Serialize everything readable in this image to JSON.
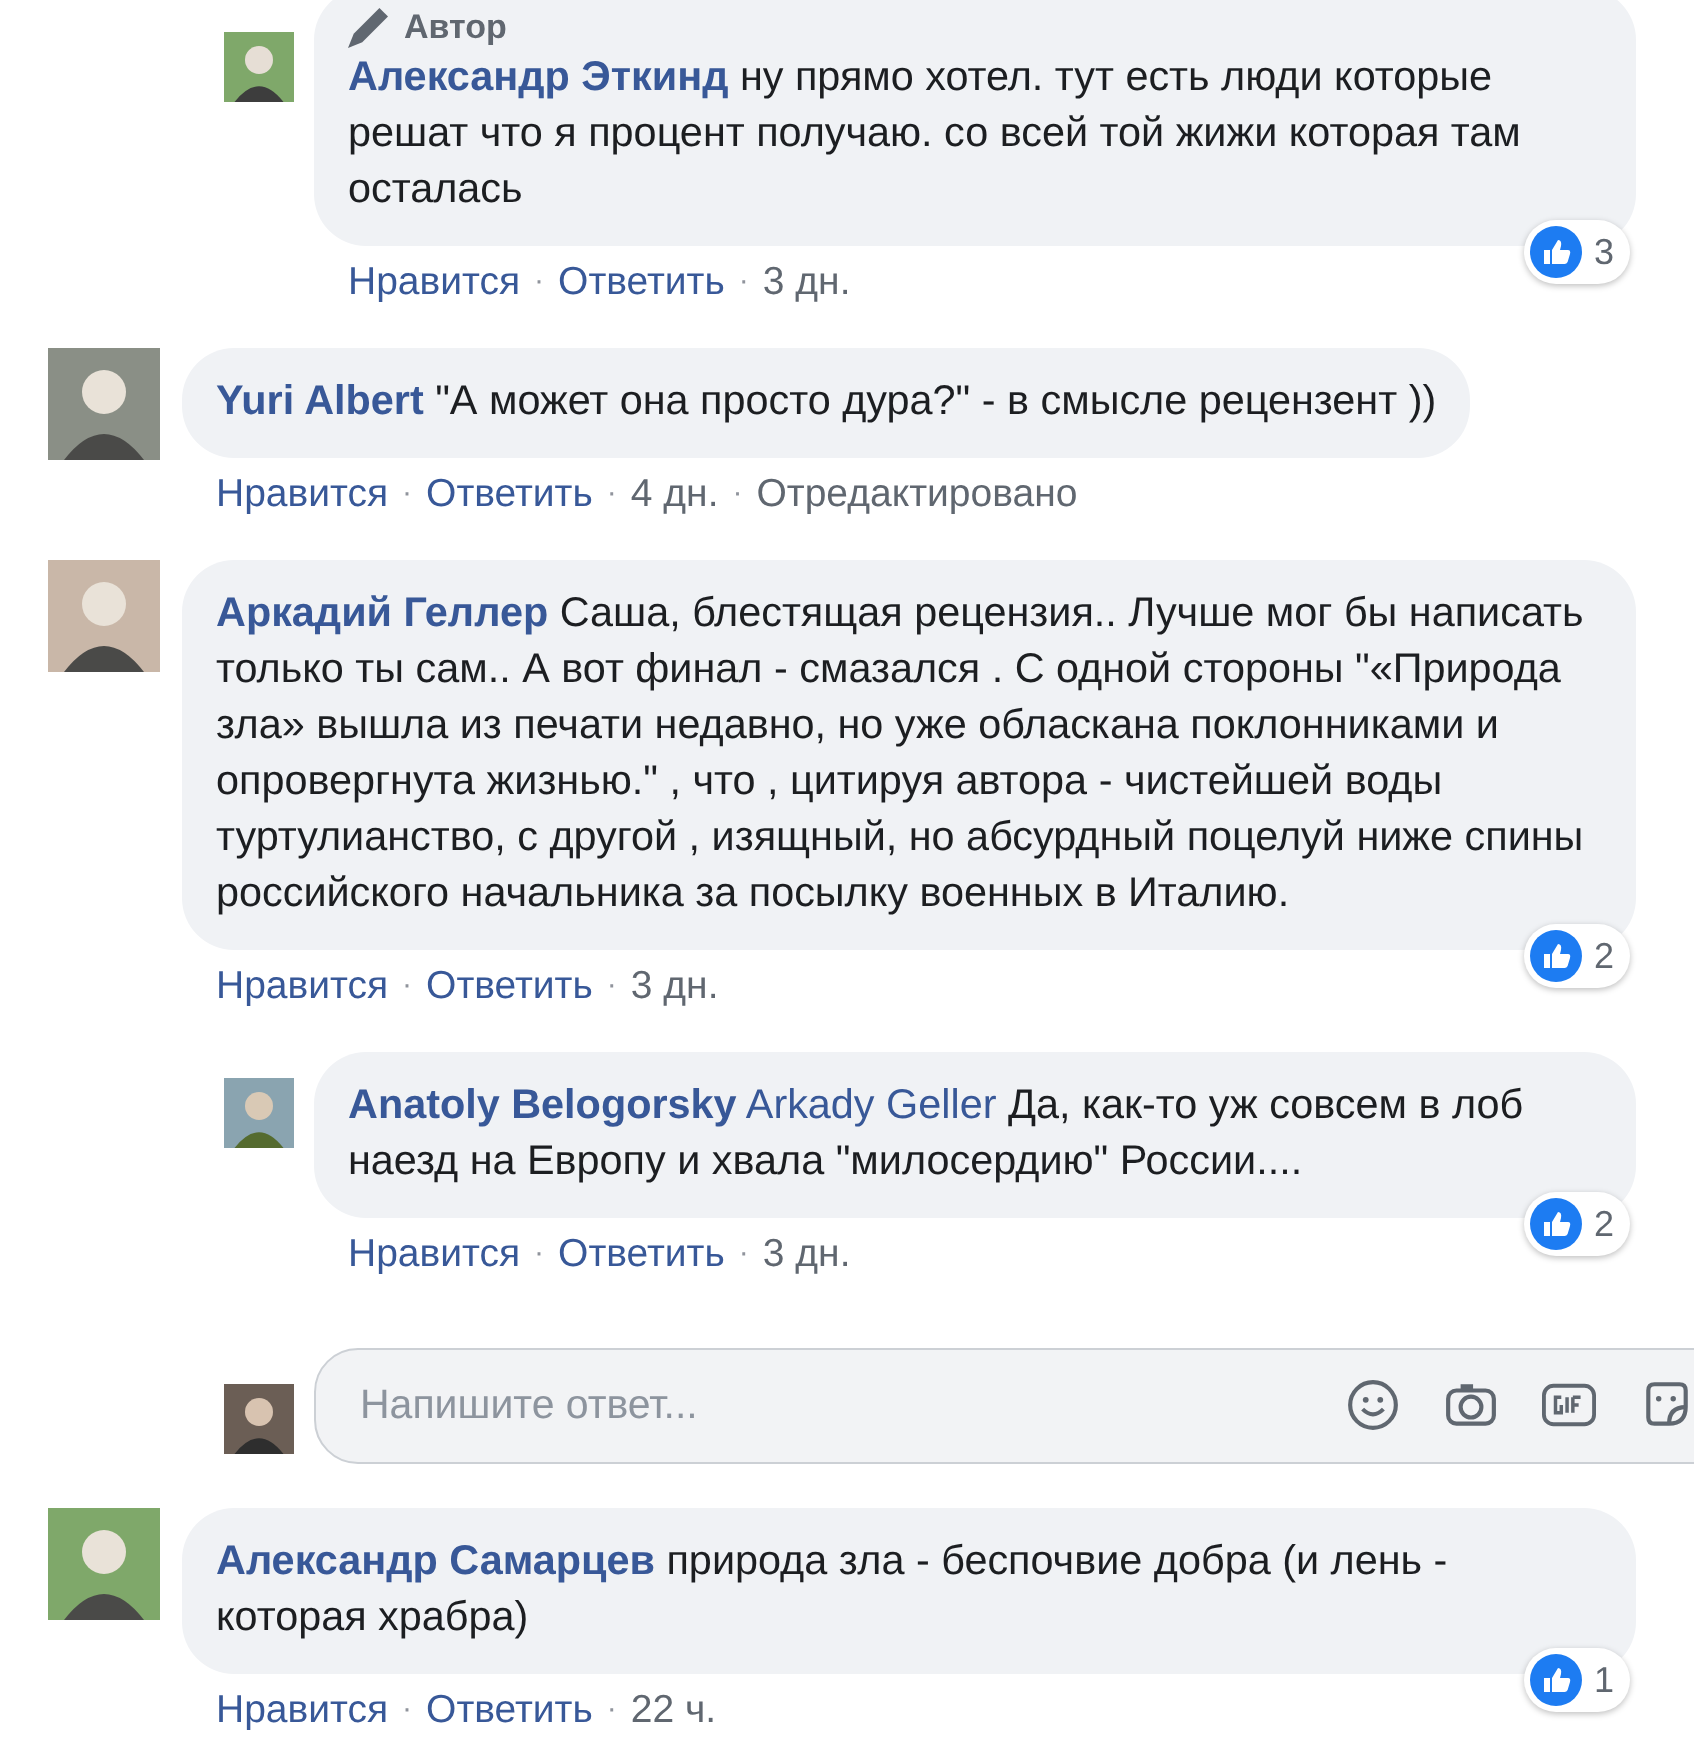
{
  "meta_separator": "·",
  "continued_replies": [
    {
      "author": "Александр Эткинд",
      "badge": "Автор",
      "text": "ну прямо хотел. тут есть люди которые решат что я процент получаю. со всей той жижи которая там осталась",
      "actions": [
        "Нравится",
        "Ответить"
      ],
      "time": "3 дн.",
      "likes": "3"
    }
  ],
  "comments": [
    {
      "author": "Yuri Albert",
      "text": "\"А может она просто дура?\" - в смысле рецензент ))",
      "actions": [
        "Нравится",
        "Ответить"
      ],
      "time": "4 дн.",
      "edited": "Отредактировано"
    },
    {
      "author": "Аркадий Геллер",
      "text": "Саша, блестящая рецензия.. Лучше мог бы написать только ты сам.. А вот финал - смазался . С одной стороны \"«Природа зла» вышла из печати недавно, но уже обласкана поклонниками и опровергнута жизнью.\" , что , цитируя автора - чистейшей воды туртулианство, с другой , изящный, но абсурдный поцелуй ниже спины российского начальника за посылку военных в Италию.",
      "actions": [
        "Нравится",
        "Ответить"
      ],
      "time": "3 дн.",
      "likes": "2",
      "children": [
        {
          "author": "Anatoly Belogorsky",
          "mention": "Arkady Geller",
          "text": "Да, как-то уж совсем в лоб наезд на Европу и хвала \"милосердию\" России....",
          "actions": [
            "Нравится",
            "Ответить"
          ],
          "time": "3 дн.",
          "likes": "2"
        }
      ],
      "reply_field": {
        "placeholder": "Напишите ответ..."
      }
    },
    {
      "author": "Александр Самарцев",
      "text": "природа зла - беспочвие добра (и лень - которая храбра)",
      "actions": [
        "Нравится",
        "Ответить"
      ],
      "time": "22 ч.",
      "likes": "1"
    }
  ]
}
